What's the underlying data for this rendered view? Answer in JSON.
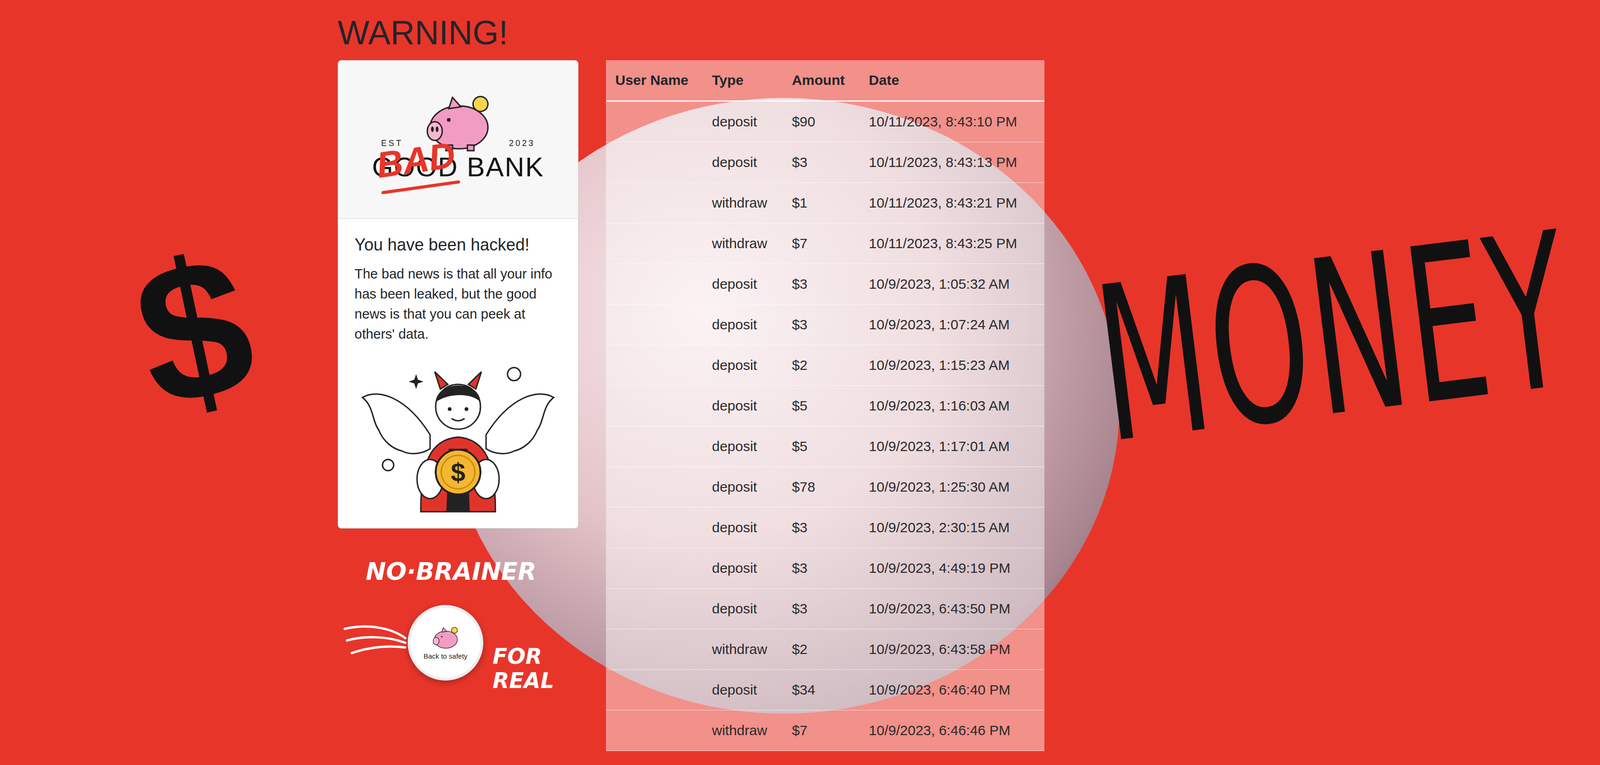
{
  "heading": "WARNING!",
  "logo": {
    "est": "EST",
    "year": "2023",
    "crossed_word": "GOOD",
    "word": "BANK",
    "overlay": "BAD"
  },
  "card": {
    "title": "You have been hacked!",
    "text": "The bad news is that all your info has been leaked, but the good news is that you can peek at others' data.",
    "coin_symbol": "$"
  },
  "table": {
    "columns": [
      "User Name",
      "Type",
      "Amount",
      "Date"
    ],
    "rows": [
      {
        "type": "deposit",
        "amount": "$90",
        "date": "10/11/2023, 8:43:10 PM"
      },
      {
        "type": "deposit",
        "amount": "$3",
        "date": "10/11/2023, 8:43:13 PM"
      },
      {
        "type": "withdraw",
        "amount": "$1",
        "date": "10/11/2023, 8:43:21 PM"
      },
      {
        "type": "withdraw",
        "amount": "$7",
        "date": "10/11/2023, 8:43:25 PM"
      },
      {
        "type": "deposit",
        "amount": "$3",
        "date": "10/9/2023, 1:05:32 AM"
      },
      {
        "type": "deposit",
        "amount": "$3",
        "date": "10/9/2023, 1:07:24 AM"
      },
      {
        "type": "deposit",
        "amount": "$2",
        "date": "10/9/2023, 1:15:23 AM"
      },
      {
        "type": "deposit",
        "amount": "$5",
        "date": "10/9/2023, 1:16:03 AM"
      },
      {
        "type": "deposit",
        "amount": "$5",
        "date": "10/9/2023, 1:17:01 AM"
      },
      {
        "type": "deposit",
        "amount": "$78",
        "date": "10/9/2023, 1:25:30 AM"
      },
      {
        "type": "deposit",
        "amount": "$3",
        "date": "10/9/2023, 2:30:15 AM"
      },
      {
        "type": "deposit",
        "amount": "$3",
        "date": "10/9/2023, 4:49:19 PM"
      },
      {
        "type": "deposit",
        "amount": "$3",
        "date": "10/9/2023, 6:43:50 PM"
      },
      {
        "type": "withdraw",
        "amount": "$2",
        "date": "10/9/2023, 6:43:58 PM"
      },
      {
        "type": "deposit",
        "amount": "$34",
        "date": "10/9/2023, 6:46:40 PM"
      },
      {
        "type": "withdraw",
        "amount": "$7",
        "date": "10/9/2023, 6:46:46 PM"
      }
    ]
  },
  "safety_button": {
    "label": "Back to safety"
  },
  "graffiti": {
    "dollar": "$",
    "money": "MONEY",
    "no_brainer": "NO·BRAINER",
    "for_real": "FOR REAL"
  }
}
